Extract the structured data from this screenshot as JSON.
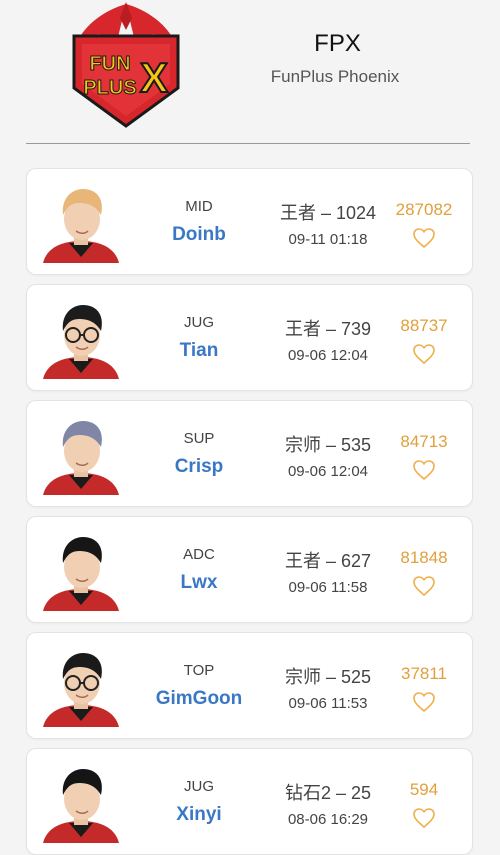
{
  "team": {
    "code": "FPX",
    "name": "FunPlus Phoenix",
    "logo_icon": "funplus-phoenix-logo",
    "logo_text_line1": "FUN",
    "logo_text_line2": "PLUS",
    "logo_text_x": "X",
    "colors": {
      "logo_red": "#d7262c",
      "logo_yellow": "#f5c518",
      "logo_black": "#1a1a1a"
    }
  },
  "colors": {
    "name_blue": "#3a78c6",
    "score_orange": "#e0a13c",
    "heart": "#efb04a"
  },
  "players": [
    {
      "role": "MID",
      "name": "Doinb",
      "rank": "王者 – 1024",
      "time": "09-11 01:18",
      "score": "287082",
      "hair": "#e9b67a",
      "glasses": false
    },
    {
      "role": "JUG",
      "name": "Tian",
      "rank": "王者 – 739",
      "time": "09-06 12:04",
      "score": "88737",
      "hair": "#1c1c1c",
      "glasses": true
    },
    {
      "role": "SUP",
      "name": "Crisp",
      "rank": "宗师 – 535",
      "time": "09-06 12:04",
      "score": "84713",
      "hair": "#7f86a6",
      "glasses": false
    },
    {
      "role": "ADC",
      "name": "Lwx",
      "rank": "王者 – 627",
      "time": "09-06 11:58",
      "score": "81848",
      "hair": "#161616",
      "glasses": false
    },
    {
      "role": "TOP",
      "name": "GimGoon",
      "rank": "宗师 – 525",
      "time": "09-06 11:53",
      "score": "37811",
      "hair": "#1a1a1a",
      "glasses": true
    },
    {
      "role": "JUG",
      "name": "Xinyi",
      "rank": "钻石2 – 25",
      "time": "08-06 16:29",
      "score": "594",
      "hair": "#151515",
      "glasses": false
    }
  ]
}
